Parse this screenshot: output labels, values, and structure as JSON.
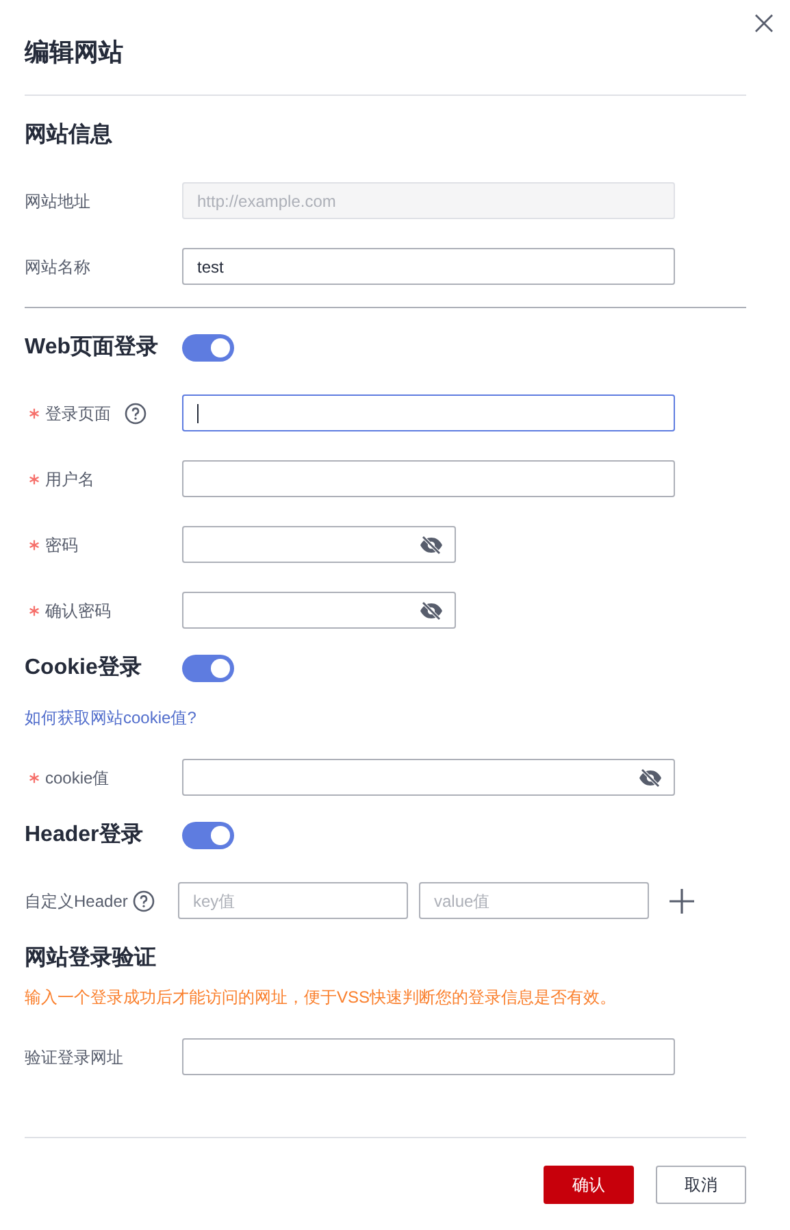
{
  "dialog": {
    "title": "编辑网站"
  },
  "rows": [
    {
      "kind": "divider"
    },
    {
      "kind": "heading",
      "title": "网站信息"
    },
    {
      "kind": "text",
      "label": "网站地址",
      "required": false,
      "help": false,
      "value": "http://example.com",
      "disabled": true,
      "focused": false
    },
    {
      "kind": "text",
      "label": "网站名称",
      "required": false,
      "help": false,
      "value": "test",
      "disabled": false,
      "focused": false
    },
    {
      "kind": "divider"
    },
    {
      "kind": "heading",
      "title": "Web页面登录",
      "toggle": {
        "on": true
      }
    },
    {
      "kind": "text",
      "label": "登录页面",
      "required": true,
      "help": true,
      "value": "",
      "disabled": false,
      "focused": true
    },
    {
      "kind": "text",
      "label": "用户名",
      "required": true,
      "help": false,
      "value": "",
      "disabled": false,
      "focused": false
    },
    {
      "kind": "password",
      "label": "密码",
      "required": true,
      "help": false,
      "value": "",
      "disabled": false,
      "focused": false
    },
    {
      "kind": "password",
      "label": "确认密码",
      "required": true,
      "help": false,
      "value": "",
      "disabled": false,
      "focused": false
    },
    {
      "kind": "heading",
      "title": "Cookie登录",
      "toggle": {
        "on": true
      }
    },
    {
      "kind": "link",
      "text": "如何获取网站cookie值?"
    },
    {
      "kind": "secret",
      "label": "cookie值",
      "required": true,
      "help": false,
      "value": "",
      "disabled": false,
      "focused": false
    },
    {
      "kind": "heading",
      "title": "Header登录",
      "toggle": {
        "on": true
      }
    },
    {
      "kind": "pair",
      "label": "自定义Header",
      "help": true,
      "key_placeholder": "key值",
      "value_placeholder": "value值"
    },
    {
      "kind": "heading",
      "title": "网站登录验证"
    },
    {
      "kind": "note",
      "text": "输入一个登录成功后才能访问的网址，便于VSS快速判断您的登录信息是否有效。"
    },
    {
      "kind": "text",
      "label": "验证登录网址",
      "required": false,
      "help": false,
      "value": "",
      "disabled": false,
      "focused": false
    }
  ],
  "buttons": [
    {
      "label": "确认",
      "kind": "primary"
    },
    {
      "label": "取消",
      "kind": "secondary"
    }
  ]
}
